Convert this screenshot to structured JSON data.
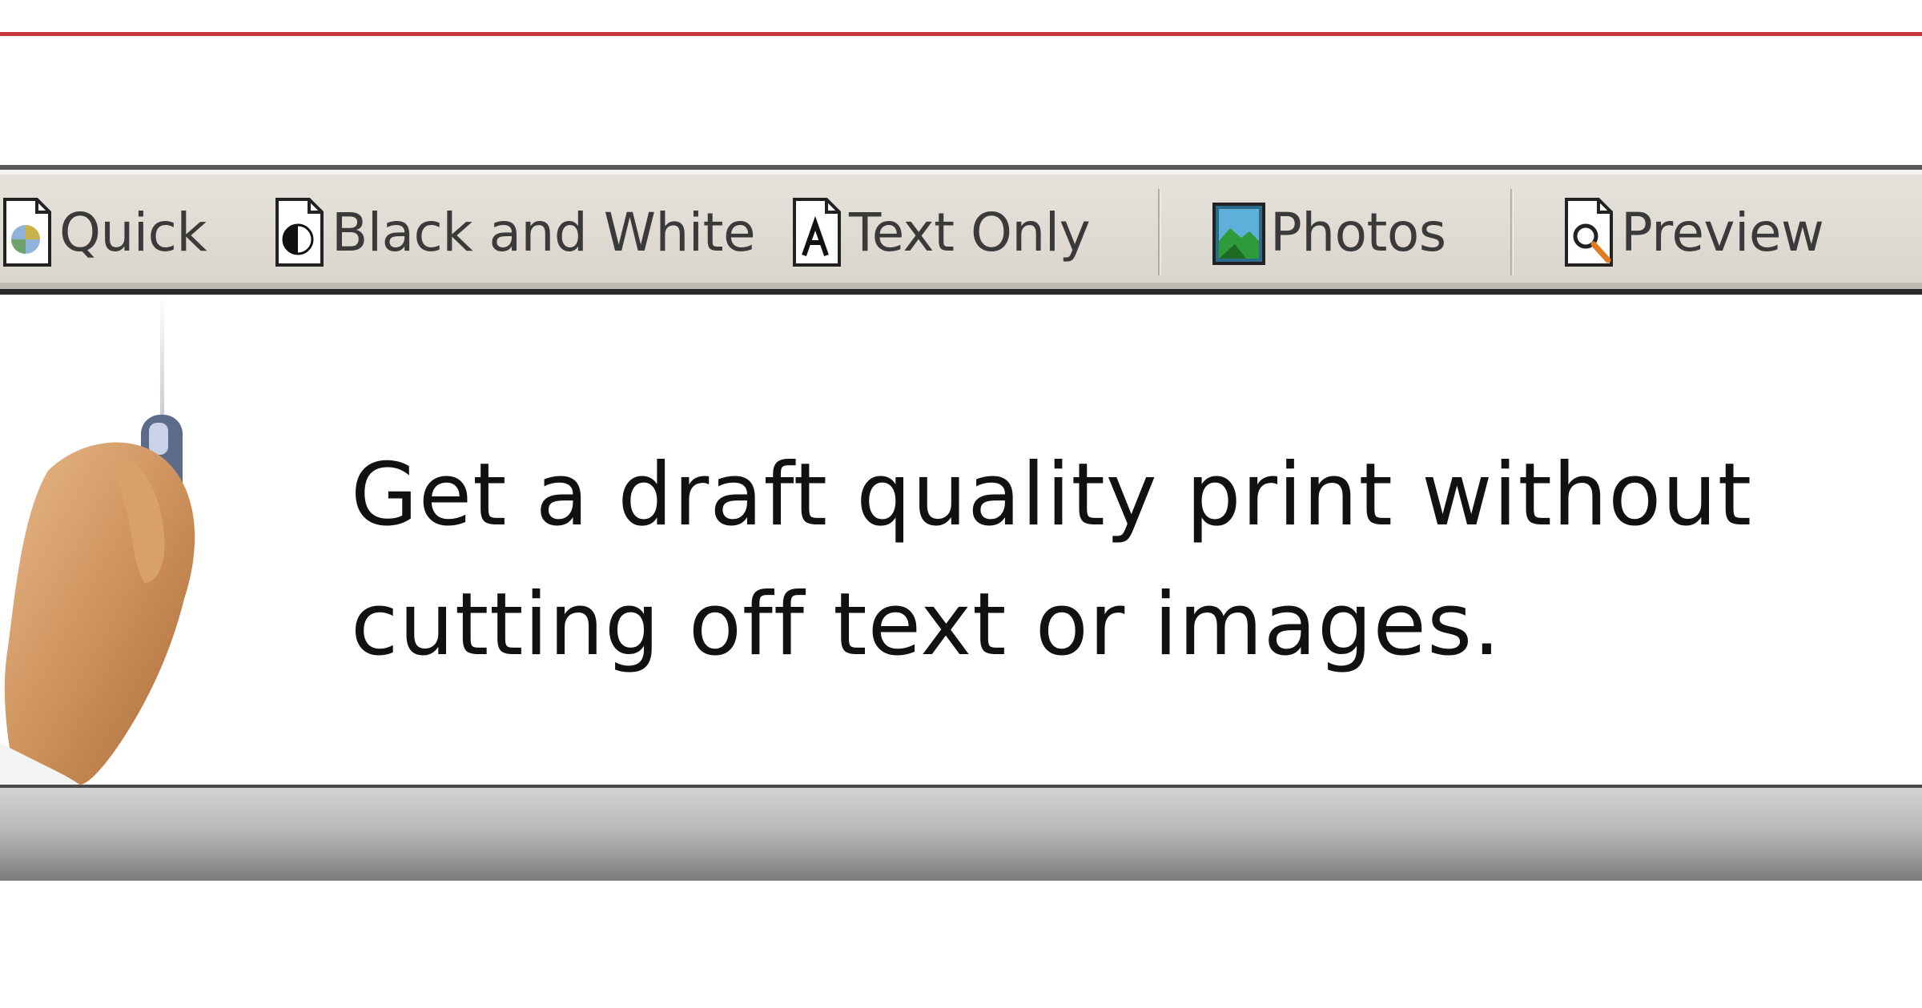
{
  "toolbar": {
    "buttons": [
      {
        "label": "Quick",
        "icon": "quick-print-icon"
      },
      {
        "label": "Black and White",
        "icon": "black-white-icon"
      },
      {
        "label": "Text Only",
        "icon": "text-only-icon"
      },
      {
        "label": "Photos",
        "icon": "photo-icon"
      },
      {
        "label": "Preview",
        "icon": "preview-icon"
      }
    ]
  },
  "banner": {
    "text": "Get a draft quality print without\ncutting off text or images."
  },
  "colors": {
    "top_rule": "#c8343f",
    "toolbar_bg": "#e0ddd5",
    "text": "#111111"
  }
}
